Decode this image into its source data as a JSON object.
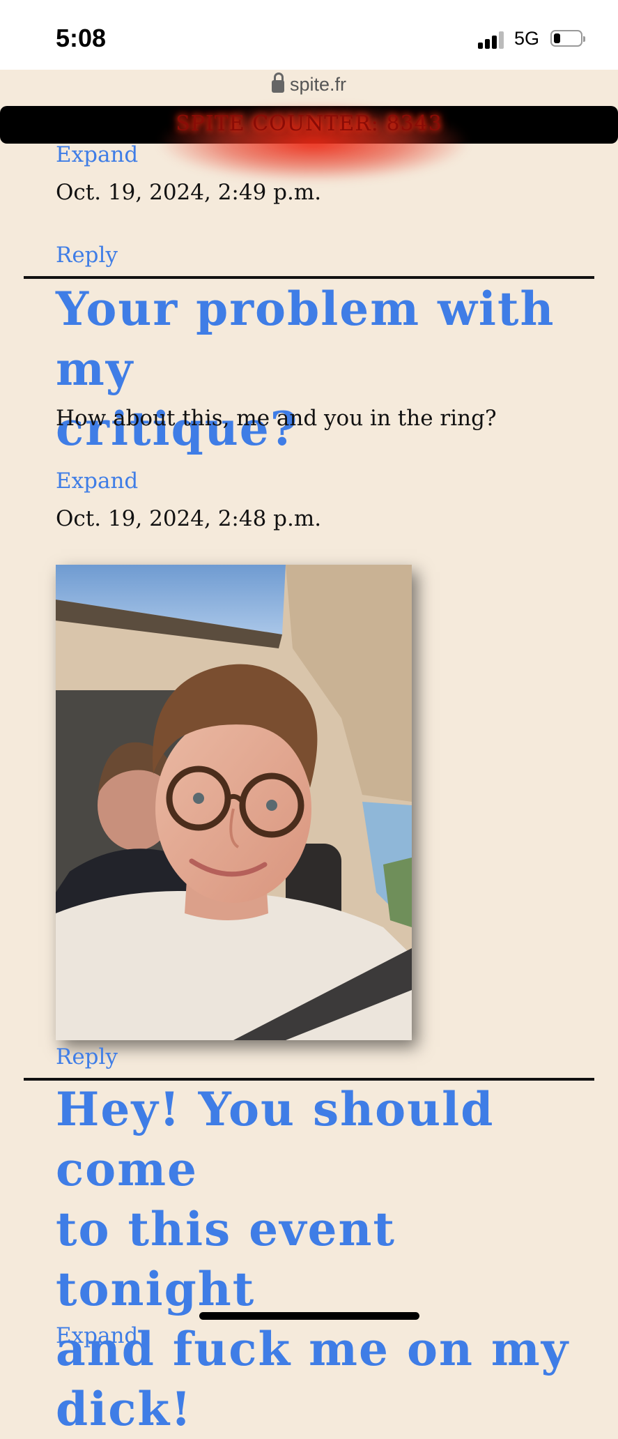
{
  "status_bar": {
    "time": "5:08",
    "network": "5G"
  },
  "browser": {
    "url": "spite.fr"
  },
  "counter": {
    "text": "SPITE COUNTER: 8343"
  },
  "posts": [
    {
      "expand_label": "Expand",
      "date": "Oct. 19, 2024, 2:49 p.m.",
      "reply_label": "Reply"
    },
    {
      "title_line1": "Your problem with my",
      "title_line2": "critique?",
      "body": "How about this, me and you in the ring?",
      "expand_label": "Expand",
      "date": "Oct. 19, 2024, 2:48 p.m.",
      "reply_label": "Reply"
    },
    {
      "title_lines": [
        "Hey! You should come",
        "to this event tonight",
        "and fuck me on my",
        "dick!"
      ],
      "expand_label": "Expand"
    }
  ],
  "colors": {
    "background": "#f5eadb",
    "link": "#3f7de6",
    "counter_glow": "#e8281a"
  }
}
